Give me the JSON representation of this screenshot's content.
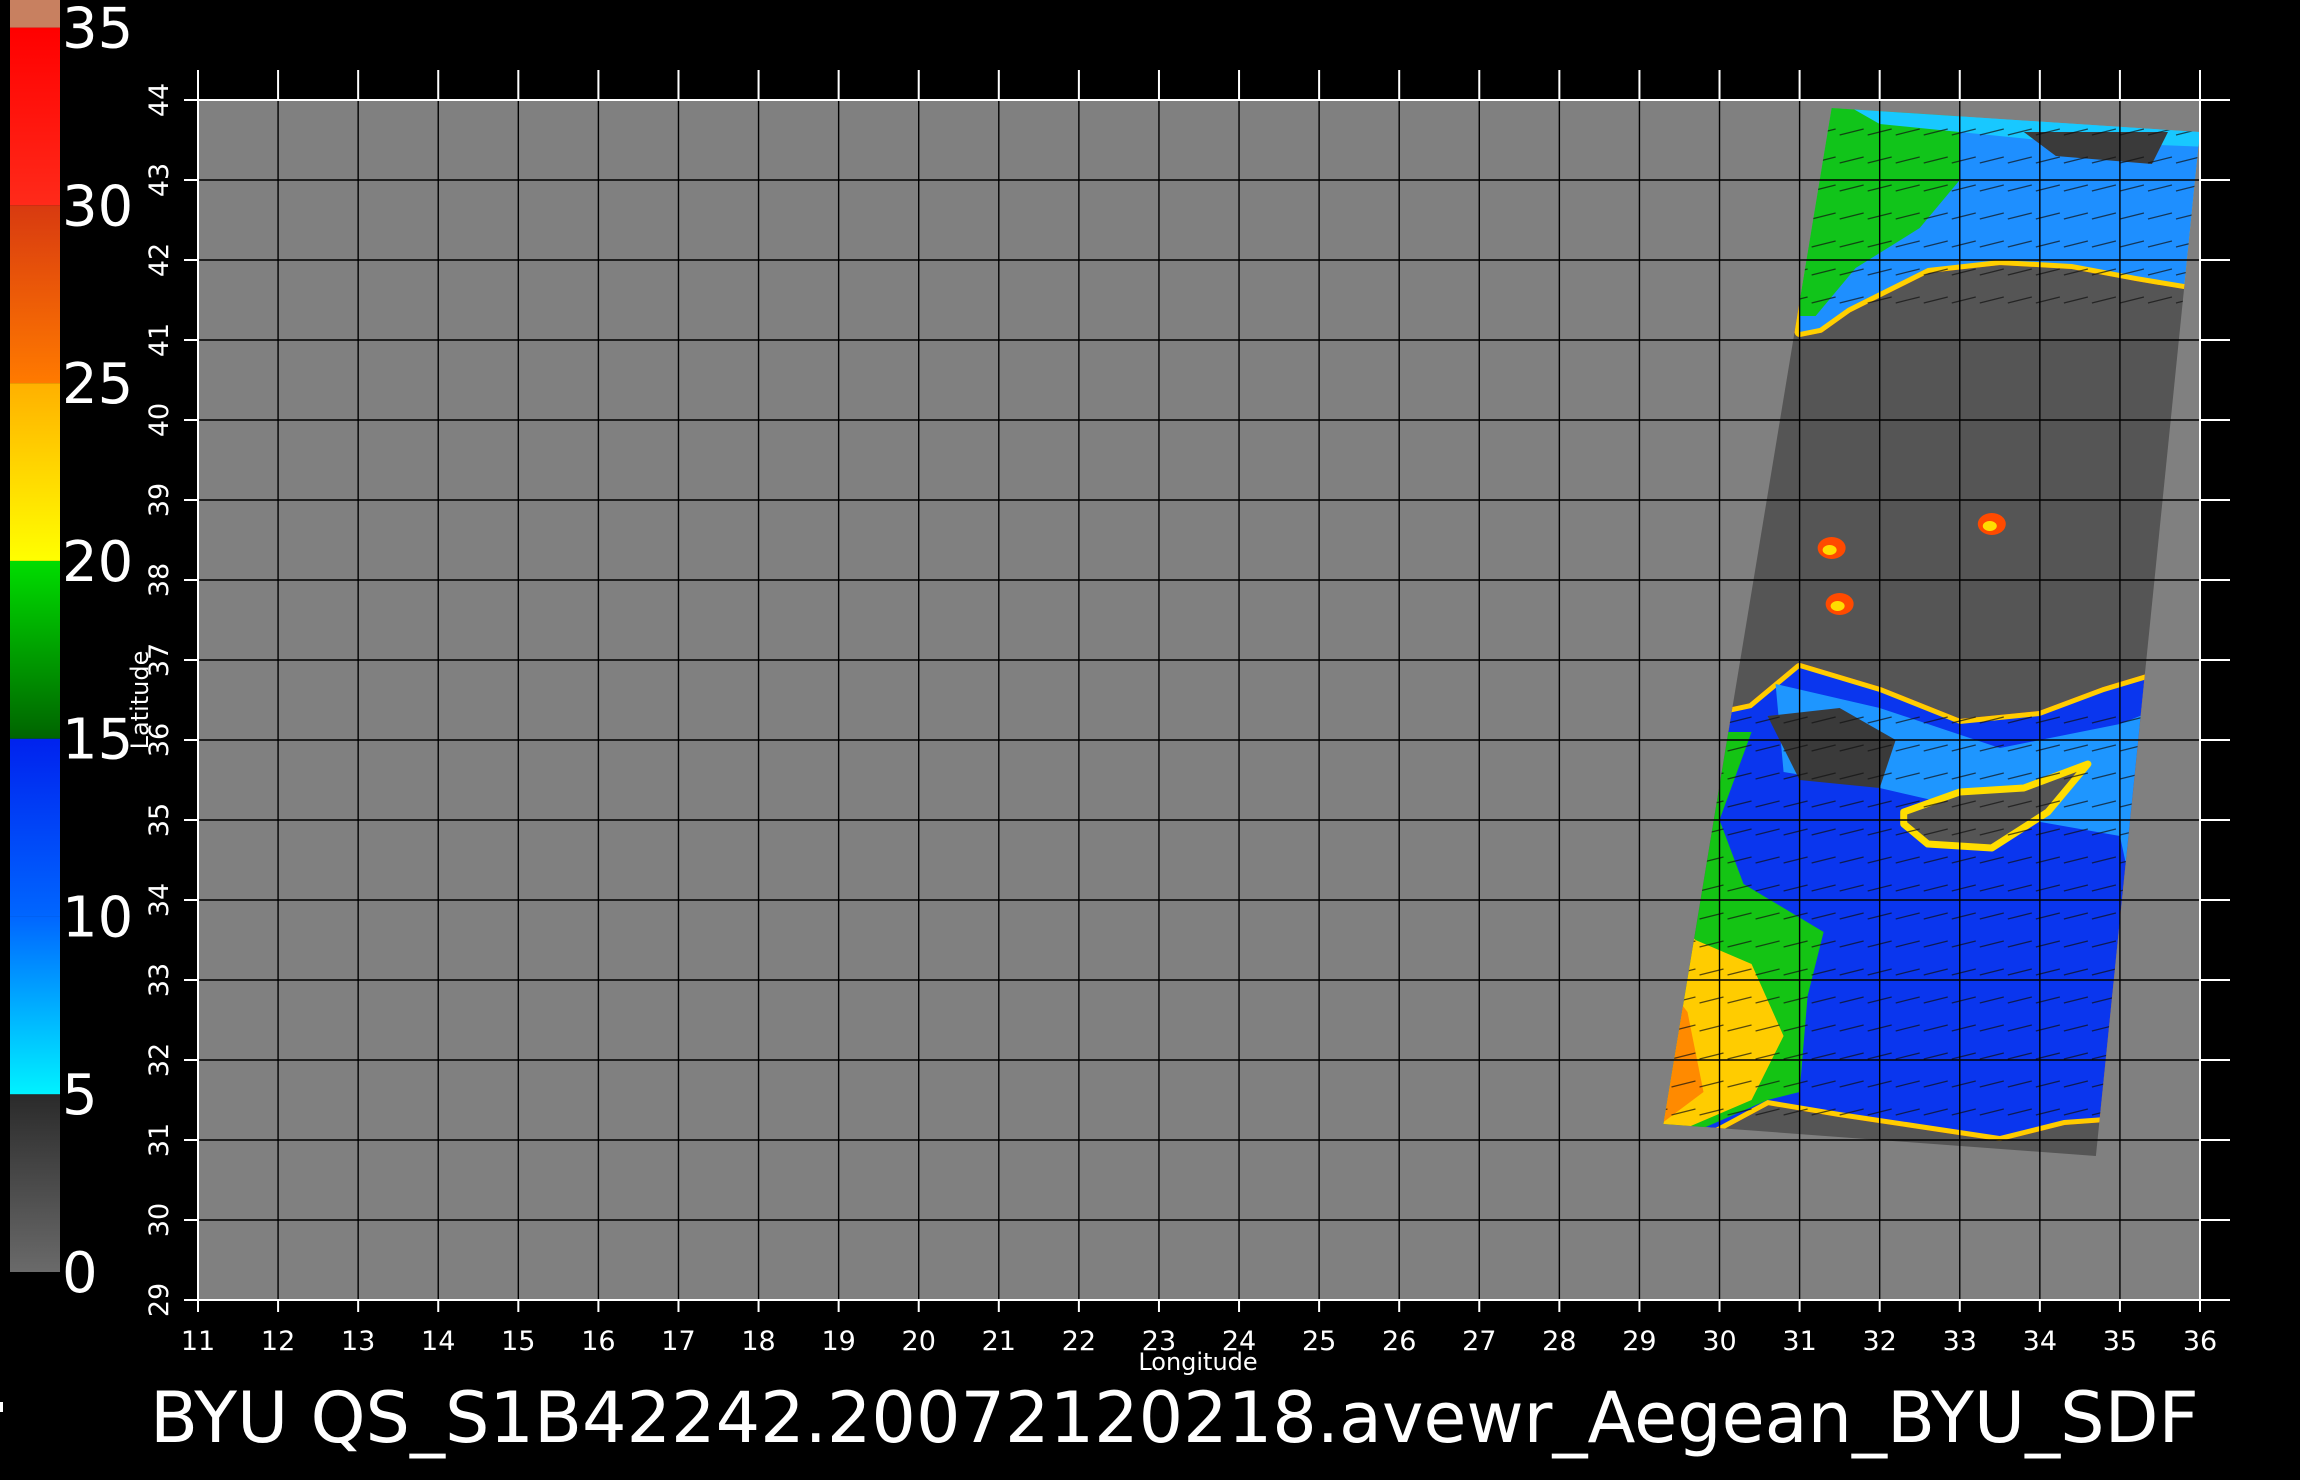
{
  "map": {
    "background": "#000000",
    "ocean_mask_color": "#808080",
    "swath_land_color": "#555555",
    "lon_label": "Longitude",
    "lat_label": "Latitude",
    "lon_min": 11,
    "lon_max": 36,
    "lat_min": 29,
    "lat_max": 44,
    "lon_ticks": [
      11,
      12,
      13,
      14,
      15,
      16,
      17,
      18,
      19,
      20,
      21,
      22,
      23,
      24,
      25,
      26,
      27,
      28,
      29,
      30,
      31,
      32,
      33,
      34,
      35,
      36
    ],
    "lat_ticks": [
      29,
      30,
      31,
      32,
      33,
      34,
      35,
      36,
      37,
      38,
      39,
      40,
      41,
      42,
      43,
      44
    ],
    "caption": "BYU  QS_S1B42242.20072120218.avewr_Aegean_BYU_SDF",
    "swath_corners": [
      [
        31.4,
        43.9
      ],
      [
        36.0,
        43.6
      ],
      [
        34.7,
        30.8
      ],
      [
        29.3,
        31.2
      ]
    ],
    "land_label_spots": [
      {
        "lon": 33.4,
        "lat": 38.7,
        "label": "small lake"
      },
      {
        "lon": 31.4,
        "lat": 38.4,
        "label": "small lake"
      },
      {
        "lon": 31.5,
        "lat": 37.7,
        "label": "small lake"
      }
    ]
  },
  "colorbar": {
    "min": 0,
    "max": 35,
    "labels": [
      "0",
      "5",
      "10",
      "15",
      "20",
      "25",
      "30",
      "35"
    ],
    "segments": [
      {
        "from": 0,
        "to": 5,
        "colors": [
          "#6a6a6a",
          "#2a2a2a"
        ]
      },
      {
        "from": 5,
        "to": 10,
        "colors": [
          "#00f2ff",
          "#0066ff"
        ]
      },
      {
        "from": 10,
        "to": 15,
        "colors": [
          "#0066ff",
          "#0022ee"
        ]
      },
      {
        "from": 15,
        "to": 20,
        "colors": [
          "#006400",
          "#00dd00"
        ]
      },
      {
        "from": 20,
        "to": 25,
        "colors": [
          "#ffff00",
          "#ffb000"
        ]
      },
      {
        "from": 25,
        "to": 30,
        "colors": [
          "#ff7a00",
          "#d83a10"
        ]
      },
      {
        "from": 30,
        "to": 35,
        "colors": [
          "#ff2a1a",
          "#ff0000"
        ]
      },
      {
        "from": 35,
        "to": 36,
        "colors": [
          "#c88060",
          "#c88060"
        ]
      }
    ]
  }
}
